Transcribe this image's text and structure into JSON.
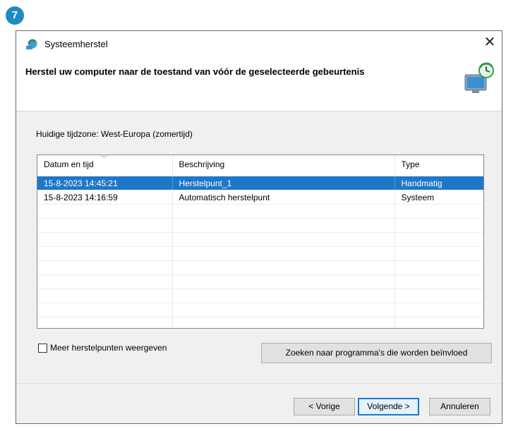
{
  "step_badge": "7",
  "window": {
    "title": "Systeemherstel",
    "close_label": "✕",
    "heading": "Herstel uw computer naar de toestand van vóór de geselecteerde gebeurtenis"
  },
  "timezone_label": "Huidige tijdzone: West-Europa (zomertijd)",
  "restore_list": {
    "columns": [
      "Datum en tijd",
      "Beschrijving",
      "Type"
    ],
    "rows": [
      {
        "date": "15-8-2023 14:45:21",
        "description": "Herstelpunt_1",
        "type": "Handmatig",
        "selected": true
      },
      {
        "date": "15-8-2023 14:16:59",
        "description": "Automatisch herstelpunt",
        "type": "Systeem",
        "selected": false
      }
    ]
  },
  "show_more": {
    "label": "Meer herstelpunten weergeven",
    "checked": false
  },
  "buttons": {
    "scan": "Zoeken naar programma's die worden beïnvloed",
    "back": "< Vorige",
    "next": "Volgende >",
    "cancel": "Annuleren"
  },
  "colors": {
    "selection": "#1f77c8",
    "badge": "#1e8bc3",
    "default_button_border": "#1779d7"
  },
  "icons": [
    "system-restore-icon",
    "close-icon",
    "restore-monitor-icon",
    "sort-arrow-icon",
    "checkbox-icon"
  ]
}
